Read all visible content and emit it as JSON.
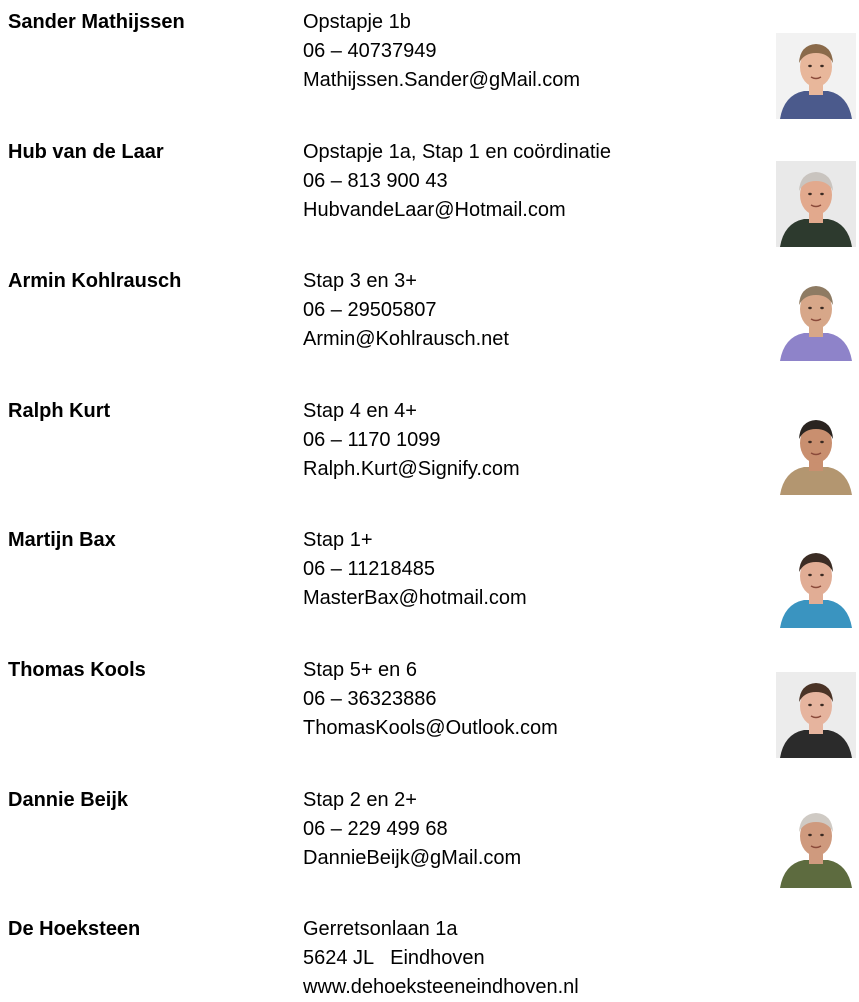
{
  "contacts": [
    {
      "name": "Sander Mathijssen",
      "role": "Opstapje 1b",
      "phone": "06 – 40737949",
      "email": "Mathijssen.Sander@gMail.com",
      "photo": {
        "bg": "#f2f2f2",
        "skin": "#e8b79b",
        "hair": "#8a6a4a",
        "shirt": "#4b5a8c"
      }
    },
    {
      "name": "Hub van de Laar",
      "role": "Opstapje 1a, Stap 1 en coördinatie",
      "phone": "06 – 813 900 43",
      "email": "HubvandeLaar@Hotmail.com",
      "photo": {
        "bg": "#e9e9e9",
        "skin": "#e2a98d",
        "hair": "#c9c4bf",
        "shirt": "#2d3a2e"
      }
    },
    {
      "name": "Armin Kohlrausch",
      "role": "Stap 3 en 3+",
      "phone": "06 – 29505807",
      "email": "Armin@Kohlrausch.net",
      "photo": {
        "bg": "#ffffff",
        "skin": "#d7a789",
        "hair": "#8e7b63",
        "shirt": "#8e83c9"
      }
    },
    {
      "name": "Ralph Kurt",
      "role": "Stap 4 en 4+",
      "phone": "06 – 1170 1099",
      "email": "Ralph.Kurt@Signify.com",
      "photo": {
        "bg": "#ffffff",
        "skin": "#c98f6f",
        "hair": "#2a2420",
        "shirt": "#b39670"
      }
    },
    {
      "name": "Martijn Bax",
      "role": "Stap 1+",
      "phone": "06 – 11218485",
      "email": "MasterBax@hotmail.com",
      "photo": {
        "bg": "#ffffff",
        "skin": "#e1ad95",
        "hair": "#3b2c24",
        "shirt": "#3a94c0"
      }
    },
    {
      "name": "Thomas Kools",
      "role": "Stap 5+ en 6",
      "phone": "06 – 36323886",
      "email": "ThomasKools@Outlook.com",
      "photo": {
        "bg": "#ececec",
        "skin": "#e6b49e",
        "hair": "#4a3326",
        "shirt": "#2b2b2b"
      }
    },
    {
      "name": "Dannie Beijk",
      "role": "Stap 2 en 2+",
      "phone": "06 – 229 499 68",
      "email": "DannieBeijk@gMail.com",
      "photo": {
        "bg": "#ffffff",
        "skin": "#cf9a7e",
        "hair": "#cfcac4",
        "shirt": "#5d6b3f"
      }
    }
  ],
  "venue": {
    "name": "De Hoeksteen",
    "street": "Gerretsonlaan 1a",
    "city": "5624 JL   Eindhoven",
    "website": "www.dehoeksteeneindhoven.nl"
  }
}
